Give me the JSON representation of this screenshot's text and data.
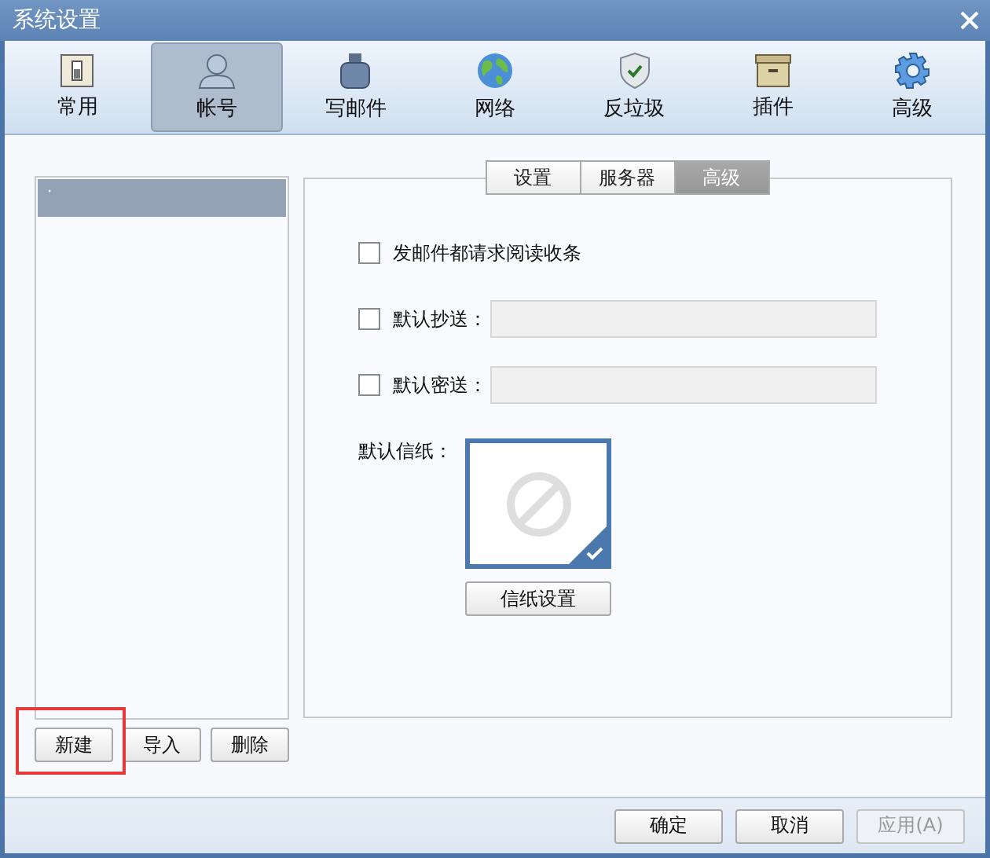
{
  "window": {
    "title": "系统设置"
  },
  "toolbar": [
    {
      "label": "常用",
      "selected": false
    },
    {
      "label": "帐号",
      "selected": true
    },
    {
      "label": "写邮件",
      "selected": false
    },
    {
      "label": "网络",
      "selected": false
    },
    {
      "label": "反垃圾",
      "selected": false
    },
    {
      "label": "插件",
      "selected": false
    },
    {
      "label": "高级",
      "selected": false
    }
  ],
  "accounts": [
    {
      "label": "·",
      "selected": true
    }
  ],
  "account_buttons": [
    {
      "label": "新建",
      "highlighted": true
    },
    {
      "label": "导入",
      "highlighted": false
    },
    {
      "label": "删除",
      "highlighted": false
    }
  ],
  "tabs": [
    {
      "label": "设置",
      "selected": false
    },
    {
      "label": "服务器",
      "selected": false
    },
    {
      "label": "高级",
      "selected": true
    }
  ],
  "options": [
    {
      "kind": "checkbox",
      "label": "发邮件都请求阅读收条",
      "checked": false
    },
    {
      "kind": "field",
      "label": "默认抄送：",
      "checked": false
    },
    {
      "kind": "field",
      "label": "默认密送：",
      "checked": false
    }
  ],
  "stationery": {
    "label": "默认信纸：",
    "selected": true,
    "button": "信纸设置"
  },
  "footer_buttons": [
    {
      "label": "确定",
      "disabled": false
    },
    {
      "label": "取消",
      "disabled": false
    },
    {
      "label": "应用(A)",
      "disabled": true
    }
  ]
}
